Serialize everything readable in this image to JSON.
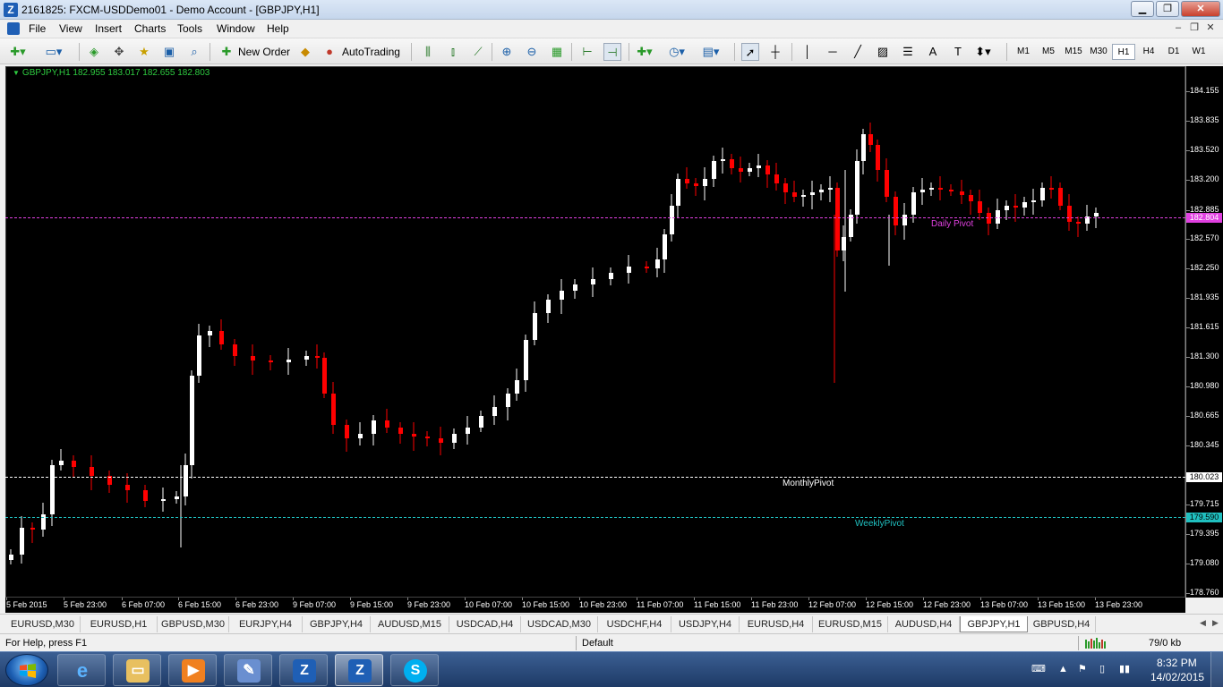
{
  "window": {
    "title": "2161825: FXCM-USDDemo01 - Demo Account - [GBPJPY,H1]",
    "minimize": "▁",
    "restore": "❐",
    "close": "✕"
  },
  "menu": {
    "items": [
      "File",
      "View",
      "Insert",
      "Charts",
      "Tools",
      "Window",
      "Help"
    ]
  },
  "toolbar": {
    "new_order_label": "New Order",
    "autotrading_label": "AutoTrading",
    "timeframes": [
      "M1",
      "M5",
      "M15",
      "M30",
      "H1",
      "H4",
      "D1",
      "W1"
    ],
    "active_timeframe": "H1",
    "icons": [
      "new-chart-icon",
      "profiles-icon",
      "market-watch-icon",
      "navigator-icon",
      "data-window-icon",
      "terminal-icon",
      "strategy-tester-icon",
      "new-order-icon",
      "autotrading-icon",
      "bar-chart-icon",
      "candlestick-icon",
      "line-chart-icon",
      "zoom-in-icon",
      "zoom-out-icon",
      "tile-windows-icon",
      "chart-shift-icon",
      "autoscroll-icon",
      "indicators-icon",
      "periods-icon",
      "templates-icon",
      "cursor-icon",
      "crosshair-icon",
      "vertical-line-icon",
      "horizontal-line-icon",
      "trendline-icon",
      "fibo-icon",
      "channel-icon",
      "text-icon",
      "text-label-icon",
      "arrows-icon"
    ]
  },
  "chart": {
    "symbol_info": "GBPJPY,H1  182.955 183.017 182.655 182.803",
    "price_labels": [
      "184.155",
      "183.835",
      "183.520",
      "183.200",
      "182.885",
      "182.570",
      "182.250",
      "181.935",
      "181.615",
      "181.300",
      "180.980",
      "180.665",
      "180.345",
      "180.023",
      "179.715",
      "179.590",
      "179.395",
      "179.080",
      "178.760"
    ],
    "time_labels": [
      "5 Feb 2015",
      "5 Feb 23:00",
      "6 Feb 07:00",
      "6 Feb 15:00",
      "6 Feb 23:00",
      "9 Feb 07:00",
      "9 Feb 15:00",
      "9 Feb 23:00",
      "10 Feb 07:00",
      "10 Feb 15:00",
      "10 Feb 23:00",
      "11 Feb 07:00",
      "11 Feb 15:00",
      "11 Feb 23:00",
      "12 Feb 07:00",
      "12 Feb 15:00",
      "12 Feb 23:00",
      "13 Feb 07:00",
      "13 Feb 15:00",
      "13 Feb 23:00"
    ],
    "daily_pivot": {
      "label": "Daily Pivot",
      "price": "182.804",
      "color": "#e040e0"
    },
    "monthly_pivot": {
      "label": "MonthlyPivot",
      "price": "180.023",
      "color": "#ffffff"
    },
    "weekly_pivot": {
      "label": "WeeklyPivot",
      "price": "179.590",
      "color": "#20c0c0"
    },
    "bull_color": "#ffffff",
    "bear_color": "#ff0000"
  },
  "tabs": {
    "items": [
      "EURUSD,M30",
      "EURUSD,H1",
      "GBPUSD,M30",
      "EURJPY,H4",
      "GBPJPY,H4",
      "AUDUSD,M15",
      "USDCAD,H4",
      "USDCAD,M30",
      "USDCHF,H4",
      "USDJPY,H4",
      "EURUSD,H4",
      "EURUSD,M15",
      "AUDUSD,H4",
      "GBPJPY,H1",
      "GBPUSD,H4"
    ],
    "active": "GBPJPY,H1"
  },
  "status": {
    "help": "For Help, press F1",
    "profile": "Default",
    "traffic": "79/0 kb"
  },
  "taskbar": {
    "apps": [
      "internet-explorer-icon",
      "file-explorer-icon",
      "media-player-icon",
      "paint-icon",
      "metatrader-icon",
      "metatrader-active-icon",
      "skype-icon"
    ],
    "time": "8:32 PM",
    "date": "14/02/2015"
  }
}
